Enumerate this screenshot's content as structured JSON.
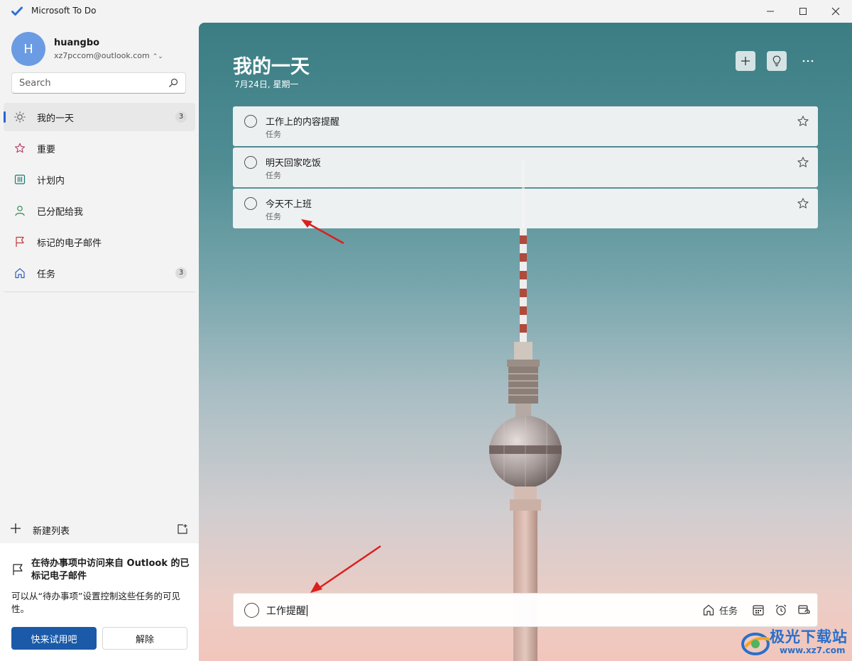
{
  "window": {
    "title": "Microsoft To Do",
    "controls": {
      "minimize": "minimize",
      "maximize": "maximize",
      "close": "close"
    }
  },
  "user": {
    "initial": "H",
    "name": "huangbo",
    "email": "xz7pccom@outlook.com"
  },
  "search": {
    "placeholder": "Search"
  },
  "sidebar": {
    "items": [
      {
        "label": "我的一天",
        "count": "3",
        "icon": "sun-icon"
      },
      {
        "label": "重要",
        "count": "",
        "icon": "star-icon"
      },
      {
        "label": "计划内",
        "count": "",
        "icon": "calendar-icon"
      },
      {
        "label": "已分配给我",
        "count": "",
        "icon": "person-icon"
      },
      {
        "label": "标记的电子邮件",
        "count": "",
        "icon": "flag-icon"
      },
      {
        "label": "任务",
        "count": "3",
        "icon": "home-icon"
      }
    ],
    "new_list_label": "新建列表"
  },
  "promo": {
    "title": "在待办事项中访问来自 Outlook 的已标记电子邮件",
    "body": "可以从“待办事项”设置控制这些任务的可见性。",
    "primary_label": "快来试用吧",
    "secondary_label": "解除"
  },
  "main": {
    "title": "我的一天",
    "date": "7月24日, 星期一",
    "tasks": [
      {
        "title": "工作上的内容提醒",
        "list": "任务"
      },
      {
        "title": "明天回家吃饭",
        "list": "任务"
      },
      {
        "title": "今天不上班",
        "list": "任务"
      }
    ],
    "add_task": {
      "value": "工作提醒",
      "list_label": "任务"
    }
  },
  "colors": {
    "accent": "#2564cf",
    "annotation_arrow": "#d9201e"
  },
  "watermark": {
    "name": "极光下载站",
    "url": "www.xz7.com"
  }
}
